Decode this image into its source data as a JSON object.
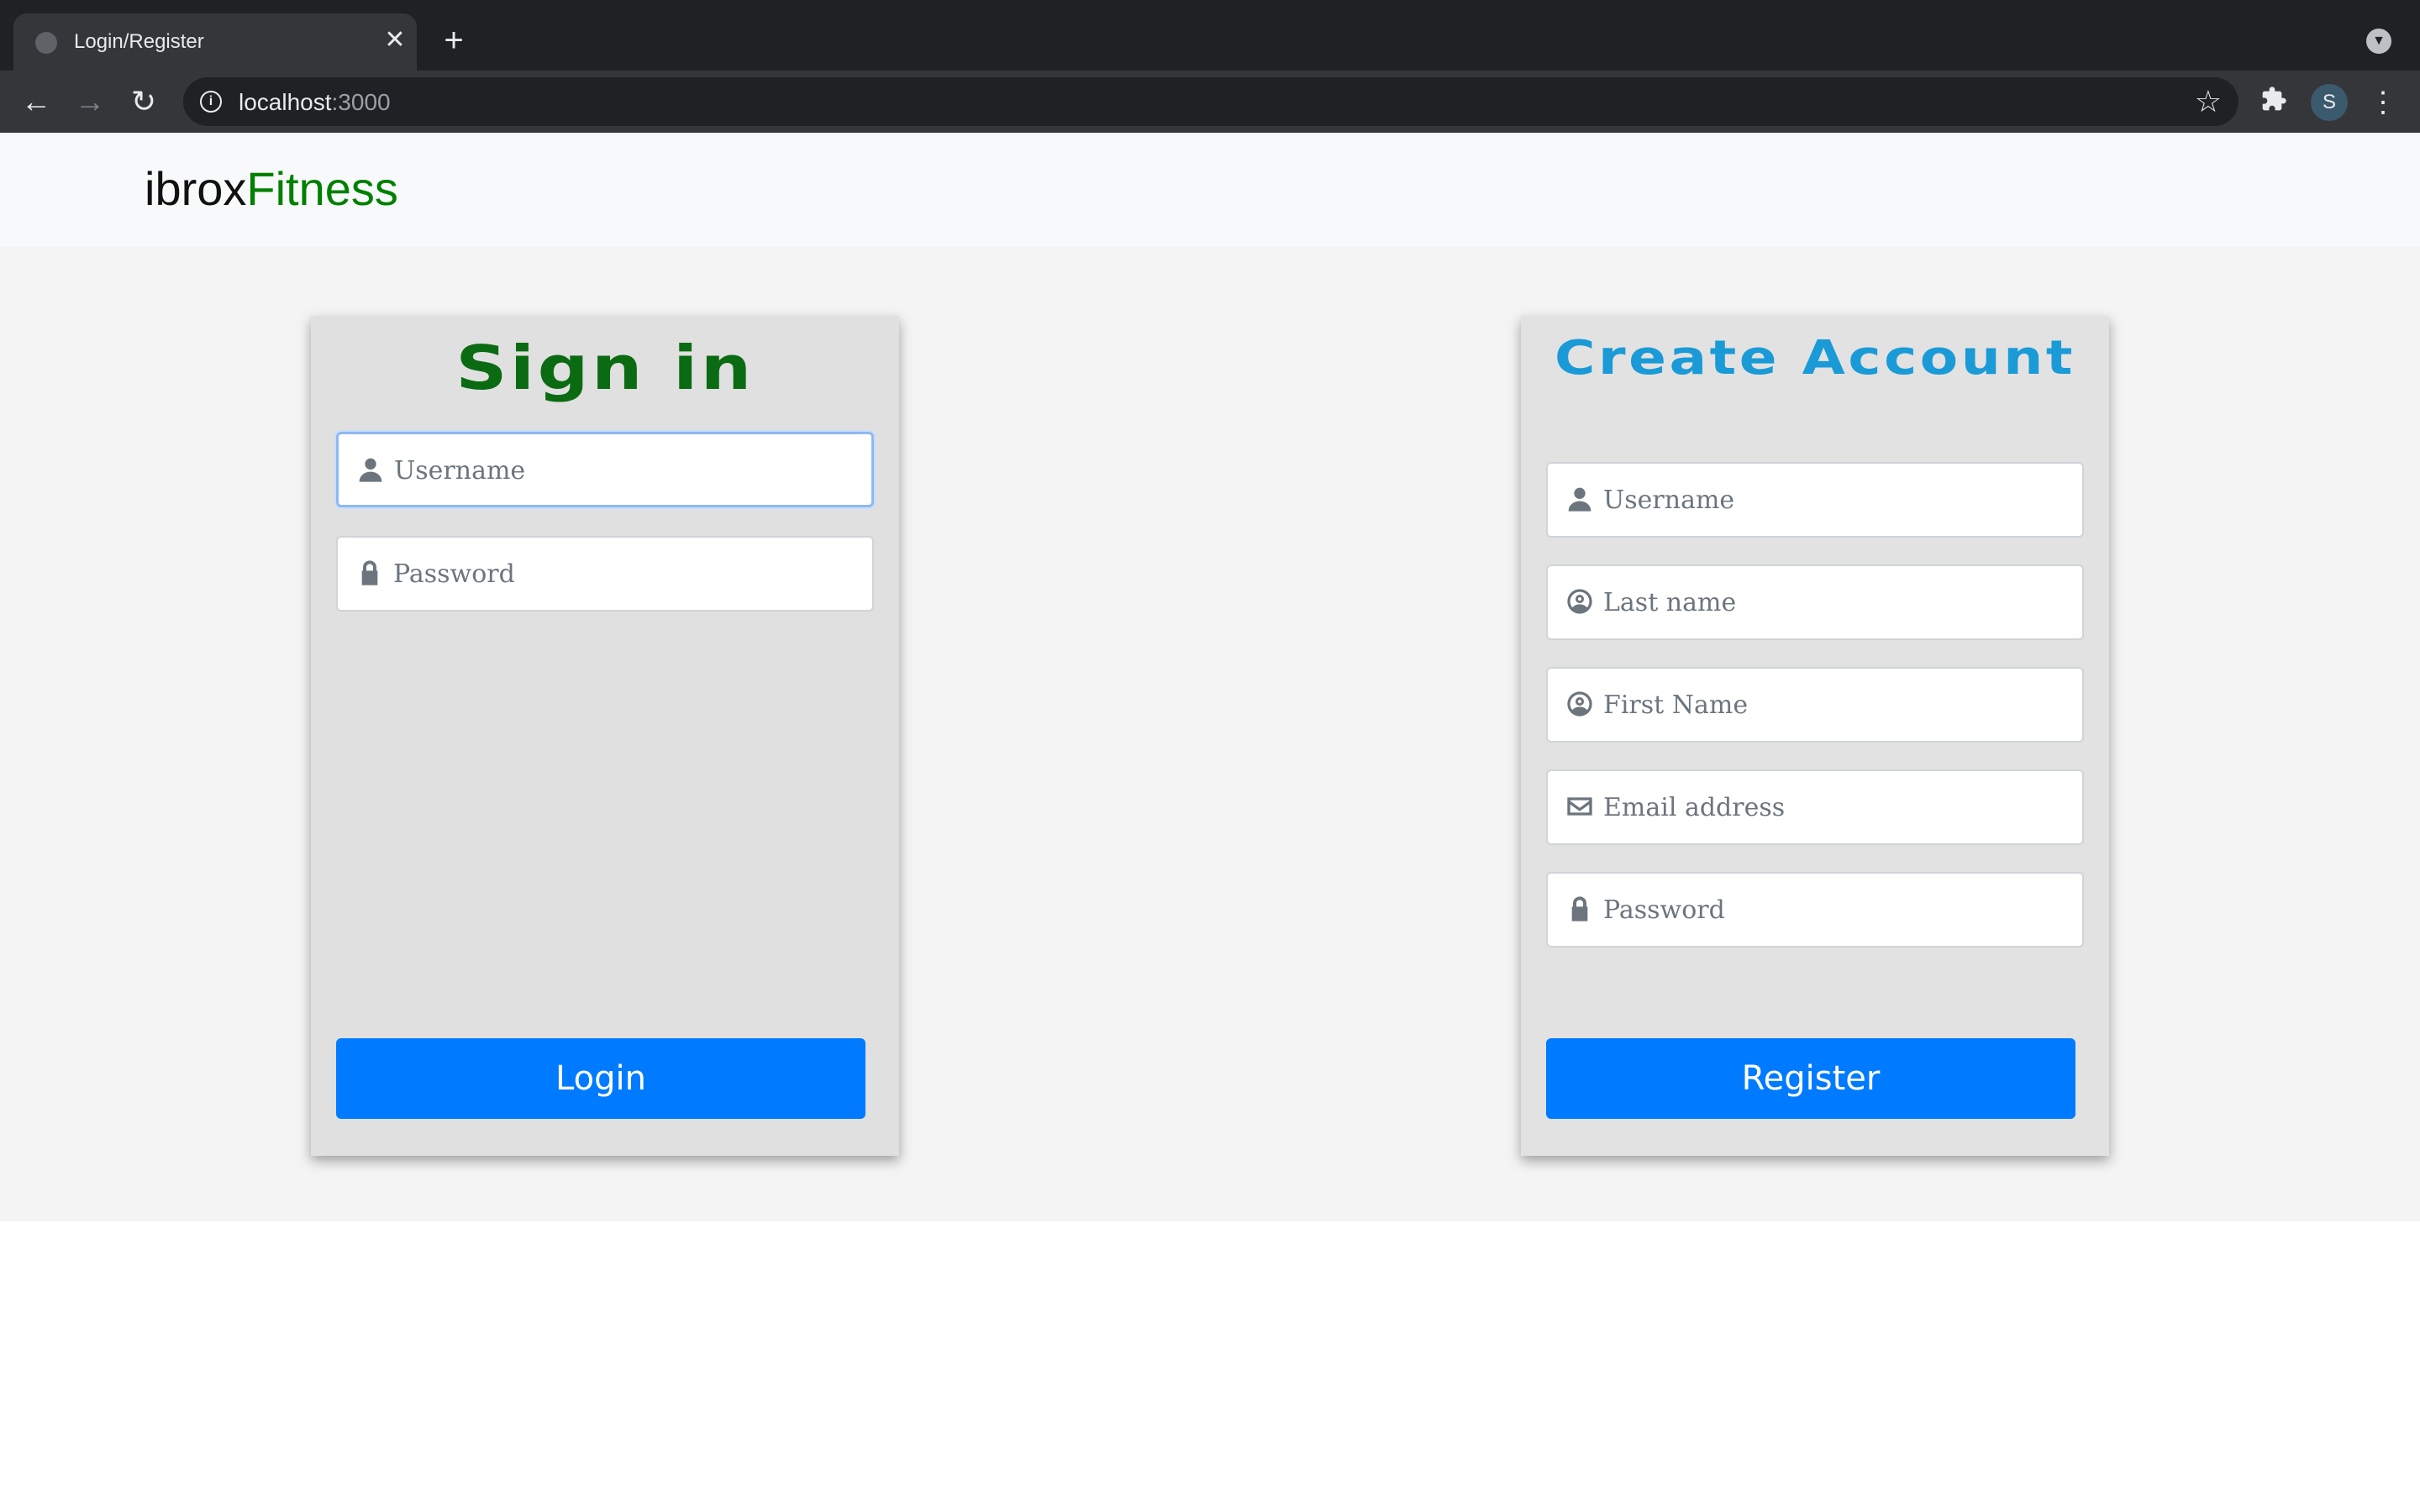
{
  "browser": {
    "tab_title": "Login/Register",
    "tab_close": "✕",
    "new_tab": "+",
    "back": "←",
    "forward": "→",
    "reload": "↻",
    "url_host": "localhost",
    "url_port": ":3000",
    "star": "☆",
    "extensions": "✱",
    "profile_initial": "S",
    "menu": "⋮",
    "tab_search": "▼"
  },
  "navbar": {
    "brand_prefix": "ibrox",
    "brand_accent": "Fitness"
  },
  "signin": {
    "title": "Sign in",
    "username_placeholder": "Username",
    "password_placeholder": "Password",
    "login_label": "Login"
  },
  "register": {
    "title": "Create Account",
    "username_placeholder": "Username",
    "lastname_placeholder": "Last name",
    "firstname_placeholder": "First Name",
    "email_placeholder": "Email address",
    "password_placeholder": "Password",
    "register_label": "Register"
  },
  "colors": {
    "brand_accent": "#008000",
    "signin_title": "#0b6b12",
    "register_title": "#1a9ad6",
    "button": "#007bff"
  }
}
